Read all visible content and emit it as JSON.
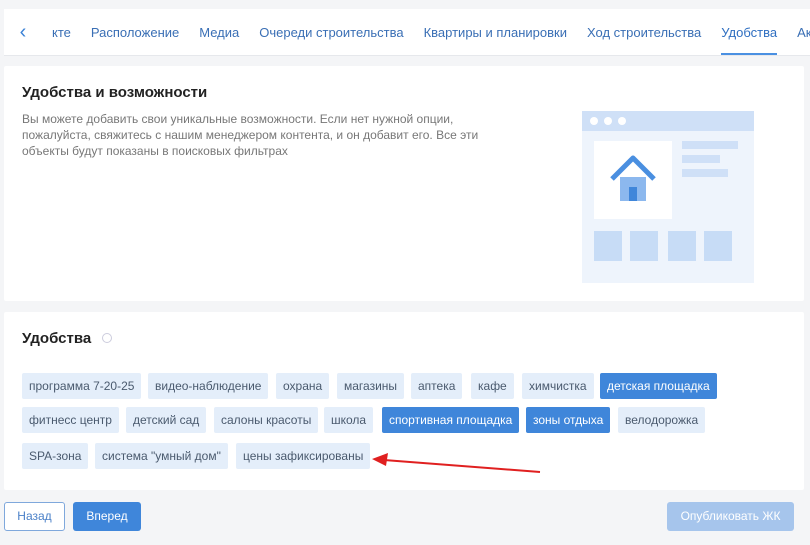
{
  "tabs": {
    "items": [
      {
        "label": "кте"
      },
      {
        "label": "Расположение"
      },
      {
        "label": "Медиа"
      },
      {
        "label": "Очереди строительства"
      },
      {
        "label": "Квартиры и планировки"
      },
      {
        "label": "Ход строительства"
      },
      {
        "label": "Удобства",
        "active": true
      },
      {
        "label": "Акции"
      }
    ]
  },
  "features": {
    "title": "Удобства и возможности",
    "description": "Вы можете добавить свои уникальные возможности. Если нет нужной опции, пожалуйста, свяжитесь с нашим менеджером контента, и он добавит его. Все эти объекты будут показаны в поисковых фильтрах"
  },
  "amenities": {
    "title": "Удобства",
    "tags": [
      {
        "label": "программа 7-20-25",
        "selected": false
      },
      {
        "label": "видео-наблюдение",
        "selected": false
      },
      {
        "label": "охрана",
        "selected": false
      },
      {
        "label": "магазины",
        "selected": false
      },
      {
        "label": "аптека",
        "selected": false
      },
      {
        "label": "кафе",
        "selected": false
      },
      {
        "label": "химчистка",
        "selected": false
      },
      {
        "label": "детская площадка",
        "selected": true
      },
      {
        "label": "фитнесс центр",
        "selected": false
      },
      {
        "label": "детский сад",
        "selected": false
      },
      {
        "label": "салоны красоты",
        "selected": false
      },
      {
        "label": "школа",
        "selected": false
      },
      {
        "label": "спортивная площадка",
        "selected": true
      },
      {
        "label": "зоны отдыха",
        "selected": true
      },
      {
        "label": "велодорожка",
        "selected": false
      },
      {
        "label": "SPA-зона",
        "selected": false
      },
      {
        "label": "система \"умный дом\"",
        "selected": false
      },
      {
        "label": "цены зафиксированы",
        "selected": false
      }
    ]
  },
  "footer": {
    "back_label": "Назад",
    "next_label": "Вперед",
    "publish_label": "Опубликовать ЖК"
  },
  "colors": {
    "accent": "#3f86da",
    "tag_bg": "#e4eefa",
    "annotation_arrow": "#e02020"
  }
}
